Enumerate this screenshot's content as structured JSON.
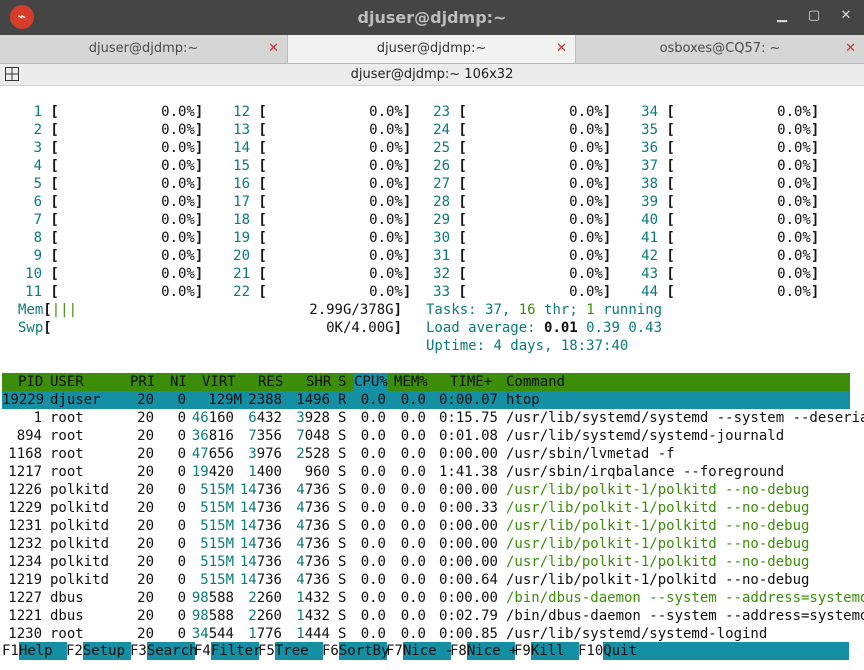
{
  "window": {
    "title": "djuser@djdmp:~",
    "subtitle": "djuser@djdmp:~ 106x32"
  },
  "tabs": [
    {
      "label": "djuser@djdmp:~",
      "active": false
    },
    {
      "label": "djuser@djdmp:~",
      "active": true
    },
    {
      "label": "osboxes@CQ57: ~",
      "active": false
    }
  ],
  "cpus": [
    {
      "id": "1",
      "pct": "0.0%"
    },
    {
      "id": "2",
      "pct": "0.0%"
    },
    {
      "id": "3",
      "pct": "0.0%"
    },
    {
      "id": "4",
      "pct": "0.0%"
    },
    {
      "id": "5",
      "pct": "0.0%"
    },
    {
      "id": "6",
      "pct": "0.0%"
    },
    {
      "id": "7",
      "pct": "0.0%"
    },
    {
      "id": "8",
      "pct": "0.0%"
    },
    {
      "id": "9",
      "pct": "0.0%"
    },
    {
      "id": "10",
      "pct": "0.0%"
    },
    {
      "id": "11",
      "pct": "0.0%"
    },
    {
      "id": "12",
      "pct": "0.0%"
    },
    {
      "id": "13",
      "pct": "0.0%"
    },
    {
      "id": "14",
      "pct": "0.0%"
    },
    {
      "id": "15",
      "pct": "0.0%"
    },
    {
      "id": "16",
      "pct": "0.0%"
    },
    {
      "id": "17",
      "pct": "0.0%"
    },
    {
      "id": "18",
      "pct": "0.0%"
    },
    {
      "id": "19",
      "pct": "0.0%"
    },
    {
      "id": "20",
      "pct": "0.0%"
    },
    {
      "id": "21",
      "pct": "0.0%"
    },
    {
      "id": "22",
      "pct": "0.0%"
    },
    {
      "id": "23",
      "pct": "0.0%"
    },
    {
      "id": "24",
      "pct": "0.0%"
    },
    {
      "id": "25",
      "pct": "0.0%"
    },
    {
      "id": "26",
      "pct": "0.0%"
    },
    {
      "id": "27",
      "pct": "0.0%"
    },
    {
      "id": "28",
      "pct": "0.0%"
    },
    {
      "id": "29",
      "pct": "0.0%"
    },
    {
      "id": "30",
      "pct": "0.0%"
    },
    {
      "id": "31",
      "pct": "0.0%"
    },
    {
      "id": "32",
      "pct": "0.0%"
    },
    {
      "id": "33",
      "pct": "0.0%"
    },
    {
      "id": "34",
      "pct": "0.0%"
    },
    {
      "id": "35",
      "pct": "0.0%"
    },
    {
      "id": "36",
      "pct": "0.0%"
    },
    {
      "id": "37",
      "pct": "0.0%"
    },
    {
      "id": "38",
      "pct": "0.0%"
    },
    {
      "id": "39",
      "pct": "0.0%"
    },
    {
      "id": "40",
      "pct": "0.0%"
    },
    {
      "id": "41",
      "pct": "0.0%"
    },
    {
      "id": "42",
      "pct": "0.0%"
    },
    {
      "id": "43",
      "pct": "0.0%"
    },
    {
      "id": "44",
      "pct": "0.0%"
    }
  ],
  "mem": {
    "label": "Mem",
    "bar": "|||",
    "value": "2.99G/378G"
  },
  "swp": {
    "label": "Swp",
    "value": "0K/4.00G"
  },
  "tasks": {
    "label": "Tasks:",
    "count": "37,",
    "thr": "16",
    "thr_label": "thr;",
    "running": "1",
    "running_label": "running"
  },
  "load": {
    "label": "Load average:",
    "l1": "0.01",
    "l5": "0.39",
    "l15": "0.43"
  },
  "uptime": {
    "label": "Uptime:",
    "value": "4 days, 18:37:40"
  },
  "columns": [
    "PID",
    "USER",
    "PRI",
    "NI",
    "VIRT",
    "RES",
    "SHR",
    "S",
    "CPU%",
    "MEM%",
    "TIME+",
    "Command"
  ],
  "processes": [
    {
      "pid": "19229",
      "user": "djuser",
      "pri": "20",
      "ni": "0",
      "virt": "129M",
      "res": "2388",
      "shr": "1496",
      "s": "R",
      "cpu": "0.0",
      "mem": "0.0",
      "time": "0:00.07",
      "cmd": "htop"
    },
    {
      "pid": "1",
      "user": "root",
      "pri": "20",
      "ni": "0",
      "virt_a": "46",
      "virt_b": "160",
      "res_a": "6",
      "res_b": "432",
      "shr_a": "3",
      "shr_b": "928",
      "s": "S",
      "cpu": "0.0",
      "mem": "0.0",
      "time": "0:15.75",
      "cmd": "/usr/lib/systemd/systemd --system --deseria"
    },
    {
      "pid": "894",
      "user": "root",
      "pri": "20",
      "ni": "0",
      "virt_a": "36",
      "virt_b": "816",
      "res_a": "7",
      "res_b": "356",
      "shr_a": "7",
      "shr_b": "048",
      "s": "S",
      "cpu": "0.0",
      "mem": "0.0",
      "time": "0:01.08",
      "cmd": "/usr/lib/systemd/systemd-journald"
    },
    {
      "pid": "1168",
      "user": "root",
      "pri": "20",
      "ni": "0",
      "virt_a": "47",
      "virt_b": "656",
      "res_a": "3",
      "res_b": "976",
      "shr_a": "2",
      "shr_b": "528",
      "s": "S",
      "cpu": "0.0",
      "mem": "0.0",
      "time": "0:00.00",
      "cmd": "/usr/sbin/lvmetad -f"
    },
    {
      "pid": "1217",
      "user": "root",
      "pri": "20",
      "ni": "0",
      "virt_a": "19",
      "virt_b": "420",
      "res_a": "1",
      "res_b": "400",
      "shr_a": "",
      "shr_b": "960",
      "s": "S",
      "cpu": "0.0",
      "mem": "0.0",
      "time": "1:41.38",
      "cmd": "/usr/sbin/irqbalance --foreground"
    },
    {
      "pid": "1226",
      "user": "polkitd",
      "pri": "20",
      "ni": "0",
      "virt_a": "515M",
      "virt_b": "",
      "res_a": "14",
      "res_b": "736",
      "shr_a": "4",
      "shr_b": "736",
      "s": "S",
      "cpu": "0.0",
      "mem": "0.0",
      "time": "0:00.00",
      "cmd": "/usr/lib/polkit-1/polkitd --no-debug",
      "thread": true
    },
    {
      "pid": "1229",
      "user": "polkitd",
      "pri": "20",
      "ni": "0",
      "virt_a": "515M",
      "virt_b": "",
      "res_a": "14",
      "res_b": "736",
      "shr_a": "4",
      "shr_b": "736",
      "s": "S",
      "cpu": "0.0",
      "mem": "0.0",
      "time": "0:00.33",
      "cmd": "/usr/lib/polkit-1/polkitd --no-debug",
      "thread": true
    },
    {
      "pid": "1231",
      "user": "polkitd",
      "pri": "20",
      "ni": "0",
      "virt_a": "515M",
      "virt_b": "",
      "res_a": "14",
      "res_b": "736",
      "shr_a": "4",
      "shr_b": "736",
      "s": "S",
      "cpu": "0.0",
      "mem": "0.0",
      "time": "0:00.00",
      "cmd": "/usr/lib/polkit-1/polkitd --no-debug",
      "thread": true
    },
    {
      "pid": "1232",
      "user": "polkitd",
      "pri": "20",
      "ni": "0",
      "virt_a": "515M",
      "virt_b": "",
      "res_a": "14",
      "res_b": "736",
      "shr_a": "4",
      "shr_b": "736",
      "s": "S",
      "cpu": "0.0",
      "mem": "0.0",
      "time": "0:00.00",
      "cmd": "/usr/lib/polkit-1/polkitd --no-debug",
      "thread": true
    },
    {
      "pid": "1234",
      "user": "polkitd",
      "pri": "20",
      "ni": "0",
      "virt_a": "515M",
      "virt_b": "",
      "res_a": "14",
      "res_b": "736",
      "shr_a": "4",
      "shr_b": "736",
      "s": "S",
      "cpu": "0.0",
      "mem": "0.0",
      "time": "0:00.00",
      "cmd": "/usr/lib/polkit-1/polkitd --no-debug",
      "thread": true
    },
    {
      "pid": "1219",
      "user": "polkitd",
      "pri": "20",
      "ni": "0",
      "virt_a": "515M",
      "virt_b": "",
      "res_a": "14",
      "res_b": "736",
      "shr_a": "4",
      "shr_b": "736",
      "s": "S",
      "cpu": "0.0",
      "mem": "0.0",
      "time": "0:00.64",
      "cmd": "/usr/lib/polkit-1/polkitd --no-debug"
    },
    {
      "pid": "1227",
      "user": "dbus",
      "pri": "20",
      "ni": "0",
      "virt_a": "98",
      "virt_b": "588",
      "res_a": "2",
      "res_b": "260",
      "shr_a": "1",
      "shr_b": "432",
      "s": "S",
      "cpu": "0.0",
      "mem": "0.0",
      "time": "0:00.00",
      "cmd": "/bin/dbus-daemon --system --address=systemd",
      "thread": true
    },
    {
      "pid": "1221",
      "user": "dbus",
      "pri": "20",
      "ni": "0",
      "virt_a": "98",
      "virt_b": "588",
      "res_a": "2",
      "res_b": "260",
      "shr_a": "1",
      "shr_b": "432",
      "s": "S",
      "cpu": "0.0",
      "mem": "0.0",
      "time": "0:02.79",
      "cmd": "/bin/dbus-daemon --system --address=systemd"
    },
    {
      "pid": "1230",
      "user": "root",
      "pri": "20",
      "ni": "0",
      "virt_a": "34",
      "virt_b": "544",
      "res_a": "1",
      "res_b": "776",
      "shr_a": "1",
      "shr_b": "444",
      "s": "S",
      "cpu": "0.0",
      "mem": "0.0",
      "time": "0:00.85",
      "cmd": "/usr/lib/systemd/systemd-logind"
    }
  ],
  "fkeys": [
    {
      "key": "F1",
      "name": "Help"
    },
    {
      "key": "F2",
      "name": "Setup"
    },
    {
      "key": "F3",
      "name": "Search"
    },
    {
      "key": "F4",
      "name": "Filter"
    },
    {
      "key": "F5",
      "name": "Tree"
    },
    {
      "key": "F6",
      "name": "SortBy"
    },
    {
      "key": "F7",
      "name": "Nice -"
    },
    {
      "key": "F8",
      "name": "Nice +"
    },
    {
      "key": "F9",
      "name": "Kill"
    },
    {
      "key": "F10",
      "name": "Quit"
    }
  ],
  "colors": {
    "titlebar": "#454545",
    "header_green": "#3c8d0a",
    "highlight_teal": "#148fa3",
    "cpu_label": "#0b7a7a",
    "close_red": "#c4342b",
    "app_icon": "#d63c2c"
  },
  "icons": {
    "app": "terminal-app-icon",
    "min": "minimize-icon",
    "max": "maximize-icon",
    "close": "close-icon",
    "tab_close": "close-icon",
    "tab_grid": "grid-icon"
  }
}
